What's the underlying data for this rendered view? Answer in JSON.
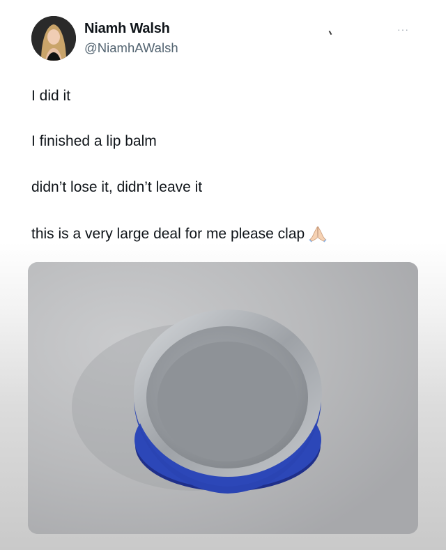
{
  "tweet": {
    "author": {
      "name": "Niamh Walsh",
      "handle": "@NiamhAWalsh"
    },
    "more_label": "···",
    "lines": [
      "I did it",
      "I finished a lip balm",
      "didn’t lose it, didn’t leave it",
      "this is a very large deal for me please clap"
    ],
    "emoji": "folded-hands-emoji"
  },
  "colors": {
    "text": "#0f1419",
    "handle": "#536471",
    "tin_rim": "#2b45b5",
    "photo_bg": "#b8b9bb"
  }
}
